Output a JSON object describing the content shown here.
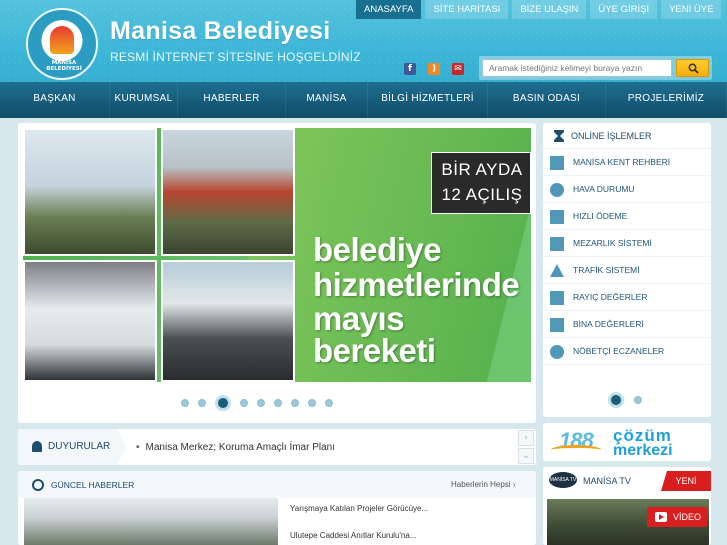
{
  "header": {
    "title": "Manisa Belediyesi",
    "subtitle": "RESMİ İNTERNET SİTESİNE HOŞGELDİNİZ",
    "logo_text": "MANİSA BELEDİYESİ"
  },
  "topnav": [
    "ANASAYFA",
    "SİTE HARİTASI",
    "BİZE ULAŞIN",
    "ÜYE GİRİŞİ",
    "YENİ ÜYE"
  ],
  "social": [
    "facebook-icon",
    "rss-icon",
    "mail-icon"
  ],
  "search": {
    "placeholder": "Aramak istediğiniz kelimeyi buraya yazın"
  },
  "mainnav": [
    "BAŞKAN",
    "KURUMSAL",
    "HABERLER",
    "MANİSA",
    "BİLGİ HİZMETLERİ",
    "BASIN ODASI",
    "PROJELERİMİZ"
  ],
  "slider": {
    "badge_line1": "BİR AYDA",
    "badge_line2": "12 AÇILIŞ",
    "slogan": [
      "belediye",
      "hizmetlerinde",
      "mayıs",
      "bereketi"
    ],
    "slide_count": 9,
    "active_slide": 3
  },
  "online": {
    "title": "ONLİNE İŞLEMLER",
    "items": [
      "MANİSA KENT REHBERİ",
      "HAVA DURUMU",
      "HIZLI ÖDEME",
      "MEZARLIK SİSTEMİ",
      "TRAFİK SİSTEMİ",
      "RAYIÇ DEĞERLER",
      "BİNA DEĞERLERİ",
      "NÖBETÇİ ECZANELER"
    ],
    "page_count": 2,
    "active_page": 1
  },
  "cozum": {
    "number": "188",
    "word1": "çözüm",
    "word2": "merkezi"
  },
  "tv": {
    "logo": "MANİSA TV",
    "title": "MANİSA TV",
    "new_label": "YENİ",
    "video_label": "VİDEO"
  },
  "duyurular": {
    "title": "DUYURULAR",
    "text": "Manisa Merkez; Koruma Amaçlı İmar Planı"
  },
  "news": {
    "title": "GÜNCEL HABERLER",
    "all_link": "Haberlerin Hepsi",
    "items": [
      "Yarışmaya Katılan Projeler Görücüye...",
      "Ulutepe Caddesi Anıtlar Kurulu'na..."
    ]
  },
  "colors": {
    "header": "#3eb6d7",
    "nav": "#175d7c",
    "accent_orange": "#f39a1f",
    "accent_red": "#d81e1e",
    "slide_green": "#5ab34f"
  }
}
